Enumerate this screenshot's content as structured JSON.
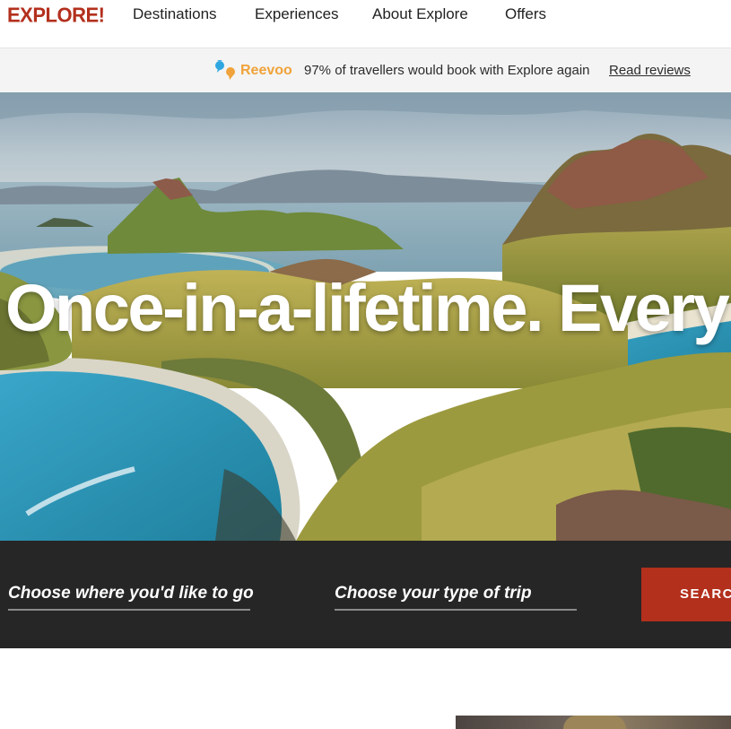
{
  "header": {
    "logo": "EXPLORE!",
    "nav": [
      {
        "label": "Destinations"
      },
      {
        "label": "Experiences"
      },
      {
        "label": "About Explore"
      },
      {
        "label": "Offers"
      }
    ]
  },
  "reevoo": {
    "brand": "Reevoo",
    "text": "97% of travellers would book with Explore again",
    "link": "Read reviews"
  },
  "hero": {
    "title": "Once-in-a-lifetime. Every"
  },
  "search": {
    "destination_label": "Choose where you'd like to go",
    "trip_type_label": "Choose your type of trip",
    "button": "SEARCH"
  },
  "colors": {
    "brand_red": "#b3301d",
    "reevoo_orange": "#f0a33a",
    "reevoo_blue": "#2fa6e0",
    "search_bar_bg": "#262626"
  }
}
